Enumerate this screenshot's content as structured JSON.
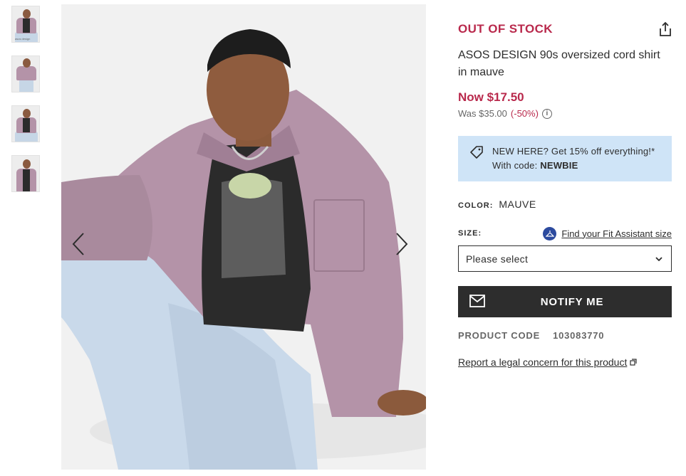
{
  "thumbnails": [
    {
      "name": "thumb-1",
      "note": "asos design"
    },
    {
      "name": "thumb-2",
      "note": ""
    },
    {
      "name": "thumb-3",
      "note": ""
    },
    {
      "name": "thumb-4",
      "note": ""
    }
  ],
  "gallery": {
    "prev_icon": "chevron-left-icon",
    "next_icon": "chevron-right-icon"
  },
  "product": {
    "stock_status": "OUT OF STOCK",
    "title": "ASOS DESIGN 90s oversized cord shirt in mauve",
    "price_now": "Now $17.50",
    "price_was": "Was $35.00",
    "discount": "(-50%)"
  },
  "promo": {
    "line1": "NEW HERE? Get 15% off everything!*",
    "line2_prefix": "With code: ",
    "code": "NEWBIE"
  },
  "color": {
    "label": "COLOR:",
    "value": "MAUVE"
  },
  "size": {
    "label": "SIZE:",
    "fit_link": "Find your Fit Assistant size",
    "select_value": "Please select"
  },
  "actions": {
    "notify_label": "NOTIFY ME"
  },
  "product_code": {
    "label": "PRODUCT CODE",
    "value": "103083770"
  },
  "legal_link": "Report a legal concern for this product",
  "colors": {
    "accent": "#b9294c",
    "promo_bg": "#cfe4f7",
    "button_bg": "#2d2d2d",
    "shirt": "#b493a8"
  }
}
